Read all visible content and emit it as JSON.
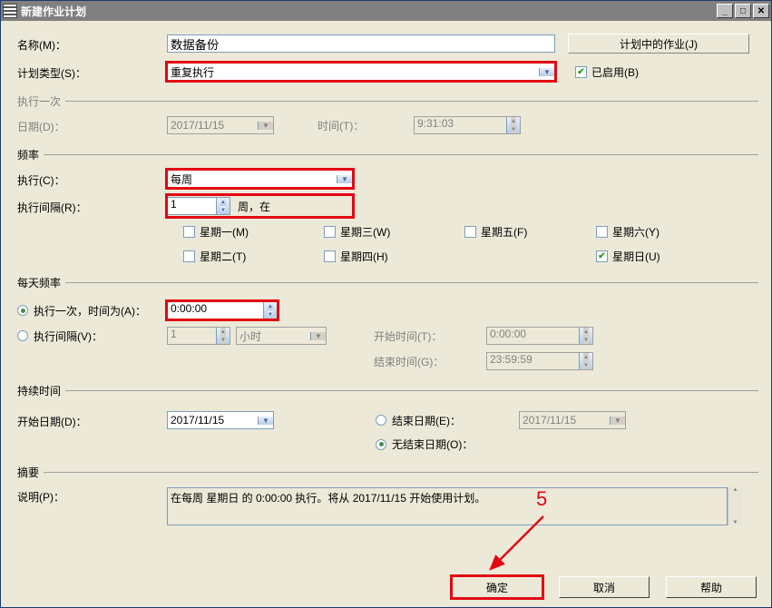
{
  "titlebar": {
    "title": "新建作业计划"
  },
  "name": {
    "label": "名称(M)：",
    "value": "数据备份"
  },
  "scheduleType": {
    "label": "计划类型(S)：",
    "value": "重复执行"
  },
  "enabled": {
    "label": "已启用(B)",
    "checked": true
  },
  "jobsInPlan": {
    "label": "计划中的作业(J)"
  },
  "executeOnce": {
    "legend": "执行一次",
    "dateLabel": "日期(D)：",
    "dateValue": "2017/11/15",
    "timeLabel": "时间(T)：",
    "timeValue": "9:31:03"
  },
  "frequency": {
    "legend": "频率",
    "executeLabel": "执行(C)：",
    "executeValue": "每周",
    "intervalLabel": "执行间隔(R)：",
    "intervalValue": "1",
    "intervalSuffix": "周，在",
    "days": {
      "mon": "星期一(M)",
      "tue": "星期二(T)",
      "wed": "星期三(W)",
      "thu": "星期四(H)",
      "fri": "星期五(F)",
      "sat": "星期六(Y)",
      "sun": "星期日(U)"
    },
    "sunChecked": true
  },
  "dailyFreq": {
    "legend": "每天频率",
    "onceLabel": "执行一次，时间为(A)：",
    "onceValue": "0:00:00",
    "intervalLabel": "执行间隔(V)：",
    "intervalValue": "1",
    "intervalUnit": "小时",
    "startLabel": "开始时间(T)：",
    "startValue": "0:00:00",
    "endLabel": "结束时间(G)：",
    "endValue": "23:59:59"
  },
  "duration": {
    "legend": "持续时间",
    "startLabel": "开始日期(D)：",
    "startValue": "2017/11/15",
    "endLabel": "结束日期(E)：",
    "endValue": "2017/11/15",
    "noEndLabel": "无结束日期(O)："
  },
  "summary": {
    "legend": "摘要",
    "descLabel": "说明(P)：",
    "descValue": "在每周 星期日 的 0:00:00 执行。将从 2017/11/15 开始使用计划。"
  },
  "buttons": {
    "ok": "确定",
    "cancel": "取消",
    "help": "帮助"
  },
  "annotation": {
    "num": "5"
  }
}
